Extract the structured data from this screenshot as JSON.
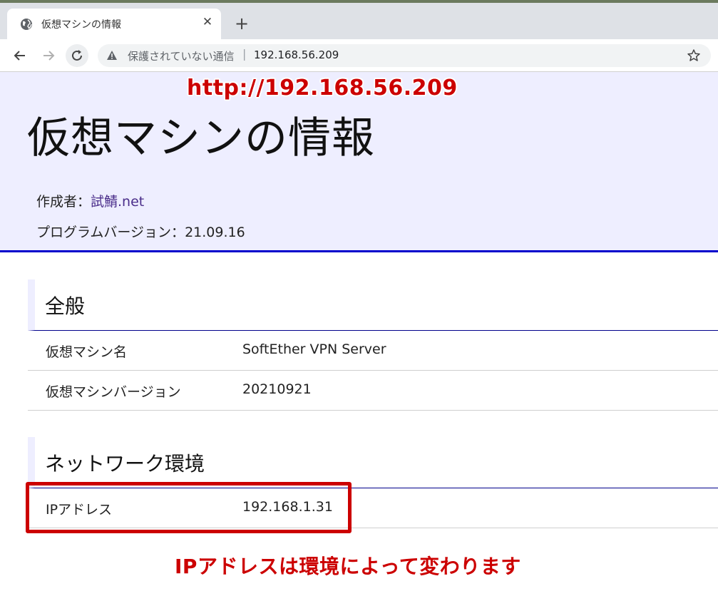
{
  "browser": {
    "tab_title": "仮想マシンの情報",
    "tab_close": "✕",
    "new_tab": "+",
    "omnibox_insecure": "保護されていない通信",
    "omnibox_separator": "|",
    "omnibox_url": "192.168.56.209"
  },
  "header": {
    "title": "仮想マシンの情報",
    "author_label": "作成者：",
    "author_link": "試鯖.net",
    "version_label": "プログラムバージョン：",
    "version_value": "21.09.16"
  },
  "sections": {
    "general": {
      "heading": "全般",
      "rows": [
        {
          "label": "仮想マシン名",
          "value": "SoftEther VPN Server"
        },
        {
          "label": "仮想マシンバージョン",
          "value": "20210921"
        }
      ]
    },
    "network": {
      "heading": "ネットワーク環境",
      "rows": [
        {
          "label": "IPアドレス",
          "value": "192.168.1.31"
        }
      ]
    }
  },
  "annotations": {
    "url": "http://192.168.56.209",
    "ip_note": "IPアドレスは環境によって変わります"
  },
  "colors": {
    "header_bg": "#eeeeff",
    "header_border": "#0000cc",
    "annotation_red": "#cc0000",
    "link": "#4a2d8a"
  }
}
